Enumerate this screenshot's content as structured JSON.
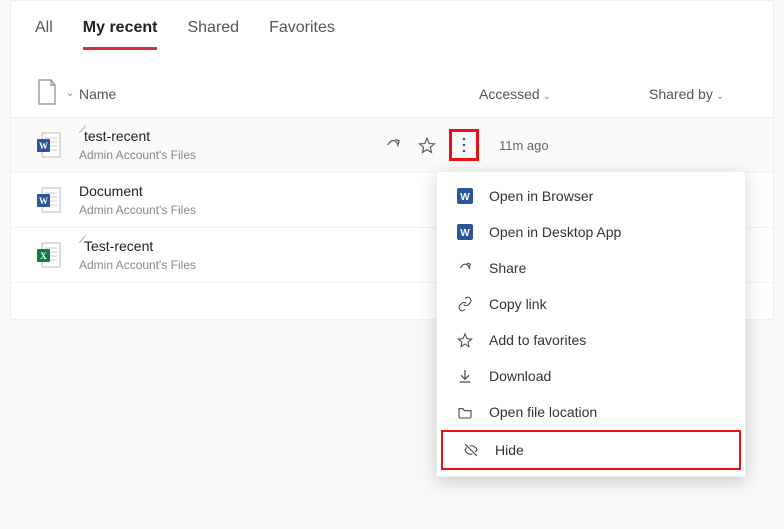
{
  "tabs": {
    "all": "All",
    "recent": "My recent",
    "shared": "Shared",
    "favorites": "Favorites"
  },
  "columns": {
    "name": "Name",
    "accessed": "Accessed",
    "shared_by": "Shared by"
  },
  "files": [
    {
      "name": "test-recent",
      "location": "Admin Account's Files",
      "accessed": "11m ago",
      "type": "word",
      "accent": true
    },
    {
      "name": "Document",
      "location": "Admin Account's Files",
      "accessed": "",
      "type": "word",
      "accent": false
    },
    {
      "name": "Test-recent",
      "location": "Admin Account's Files",
      "accessed": "",
      "type": "excel",
      "accent": true
    }
  ],
  "menu": {
    "open_browser": "Open in Browser",
    "open_desktop": "Open in Desktop App",
    "share": "Share",
    "copy_link": "Copy link",
    "add_favorites": "Add to favorites",
    "download": "Download",
    "open_location": "Open file location",
    "hide": "Hide"
  }
}
